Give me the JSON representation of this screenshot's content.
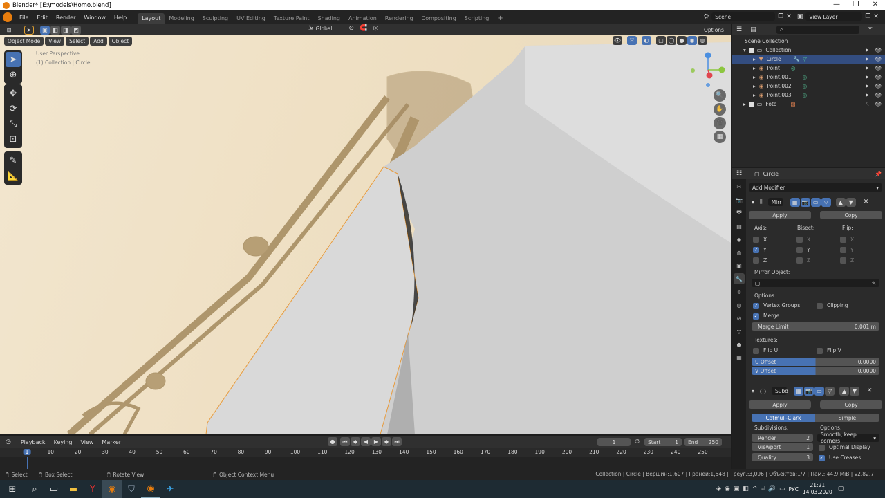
{
  "window": {
    "title": "Blender* [E:\\models\\Homo.blend]",
    "controls": [
      "—",
      "❐",
      "✕"
    ]
  },
  "menu": [
    "File",
    "Edit",
    "Render",
    "Window",
    "Help"
  ],
  "workspaces": [
    {
      "label": "Layout",
      "active": true
    },
    {
      "label": "Modeling"
    },
    {
      "label": "Sculpting"
    },
    {
      "label": "UV Editing"
    },
    {
      "label": "Texture Paint"
    },
    {
      "label": "Shading"
    },
    {
      "label": "Animation"
    },
    {
      "label": "Rendering"
    },
    {
      "label": "Compositing"
    },
    {
      "label": "Scripting"
    }
  ],
  "scene": {
    "scene_name": "Scene",
    "view_layer": "View Layer"
  },
  "viewport_header": {
    "transform_orientation": "Global",
    "options": "Options",
    "mode": "Object Mode",
    "menus": [
      "View",
      "Select",
      "Add",
      "Object"
    ]
  },
  "viewport": {
    "perspective": "User Perspective",
    "collection_info": "(1) Collection | Circle"
  },
  "outliner": {
    "search_placeholder": "",
    "items": [
      {
        "label": "Scene Collection",
        "indent": 0,
        "type": "scene"
      },
      {
        "label": "Collection",
        "indent": 1,
        "type": "collection"
      },
      {
        "label": "Circle",
        "indent": 2,
        "type": "mesh",
        "selected": true
      },
      {
        "label": "Point",
        "indent": 2,
        "type": "light"
      },
      {
        "label": "Point.001",
        "indent": 2,
        "type": "light"
      },
      {
        "label": "Point.002",
        "indent": 2,
        "type": "light"
      },
      {
        "label": "Point.003",
        "indent": 2,
        "type": "light"
      },
      {
        "label": "Foto",
        "indent": 1,
        "type": "image"
      }
    ]
  },
  "properties": {
    "object_name": "Circle",
    "add_modifier": "Add Modifier",
    "mirror": {
      "name": "Mirr",
      "apply": "Apply",
      "copy": "Copy",
      "axis_label": "Axis:",
      "bisect_label": "Bisect:",
      "flip_label": "Flip:",
      "axes": [
        {
          "l": "X",
          "axis": false,
          "bisect": false,
          "flip": false
        },
        {
          "l": "Y",
          "axis": true,
          "bisect": false,
          "flip": false
        },
        {
          "l": "Z",
          "axis": false,
          "bisect": false,
          "flip": false
        }
      ],
      "mirror_object_label": "Mirror Object:",
      "options_label": "Options:",
      "vertex_groups": "Vertex Groups",
      "clipping": "Clipping",
      "merge": "Merge",
      "merge_limit_label": "Merge Limit",
      "merge_limit_value": "0.001 m",
      "textures_label": "Textures:",
      "flip_u": "Flip U",
      "flip_v": "Flip V",
      "u_offset_label": "U Offset",
      "u_offset_value": "0.0000",
      "v_offset_label": "V Offset",
      "v_offset_value": "0.0000"
    },
    "subsurf": {
      "name": "Subd",
      "apply": "Apply",
      "copy": "Copy",
      "mode_a": "Catmull-Clark",
      "mode_b": "Simple",
      "subdivisions_label": "Subdivisions:",
      "options_label": "Options:",
      "render_label": "Render",
      "render_value": "2",
      "viewport_label": "Viewport",
      "viewport_value": "1",
      "quality_label": "Quality",
      "quality_value": "3",
      "uv_smooth": "Smooth, keep corners",
      "optimal_display": "Optimal Display",
      "use_creases": "Use Creases"
    }
  },
  "timeline": {
    "menus": [
      "Playback",
      "Keying",
      "View",
      "Marker"
    ],
    "current_frame": "1",
    "start_label": "Start",
    "start": "1",
    "end_label": "End",
    "end": "250",
    "ruler": [
      "1",
      "10",
      "20",
      "30",
      "40",
      "50",
      "60",
      "70",
      "80",
      "90",
      "100",
      "110",
      "120",
      "130",
      "140",
      "150",
      "160",
      "170",
      "180",
      "190",
      "200",
      "210",
      "220",
      "230",
      "240",
      "250"
    ]
  },
  "statusbar": {
    "select": "Select",
    "box_select": "Box Select",
    "rotate_view": "Rotate View",
    "context_menu": "Object Context Menu",
    "stats": "Collection | Circle | Вершин:1,607 | Граней:1,548 | Треуг.:3,096 | Объектов:1/7 | Пам.: 44.9 MiB | v2.82.7"
  },
  "taskbar": {
    "lang": "РУС",
    "time": "21:21",
    "date": "14.03.2020"
  }
}
